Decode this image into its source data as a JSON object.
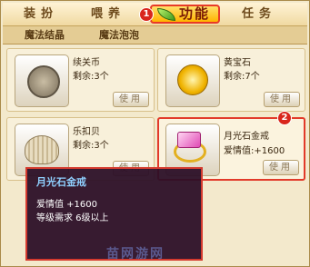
{
  "tabs": [
    {
      "label": "装扮"
    },
    {
      "label": "喂养"
    },
    {
      "label": "功能"
    },
    {
      "label": "任务"
    }
  ],
  "badges": {
    "one": "1",
    "two": "2"
  },
  "subtabs": [
    {
      "label": "魔法结晶"
    },
    {
      "label": "魔法泡泡"
    }
  ],
  "items": [
    {
      "name": "续关币",
      "count": "剩余:3个",
      "use": "使用",
      "icon": "coin-icon"
    },
    {
      "name": "黄宝石",
      "count": "剩余:7个",
      "use": "使用",
      "icon": "topaz-icon"
    },
    {
      "name": "乐扣贝",
      "count": "剩余:3个",
      "use": "使用",
      "icon": "shell-icon"
    },
    {
      "name": "月光石金戒",
      "count": "爱情值:+1600",
      "use": "使用",
      "icon": "ring-icon"
    }
  ],
  "tooltip": {
    "title": "月光石金戒",
    "line1": "爱情值 +1600",
    "line2": "等级需求 6级以上"
  },
  "watermark": "苗网游网",
  "colors": {
    "accent": "#e23a2a",
    "tab_active": "#ffb400",
    "tooltip_bg": "#2a0e26"
  }
}
